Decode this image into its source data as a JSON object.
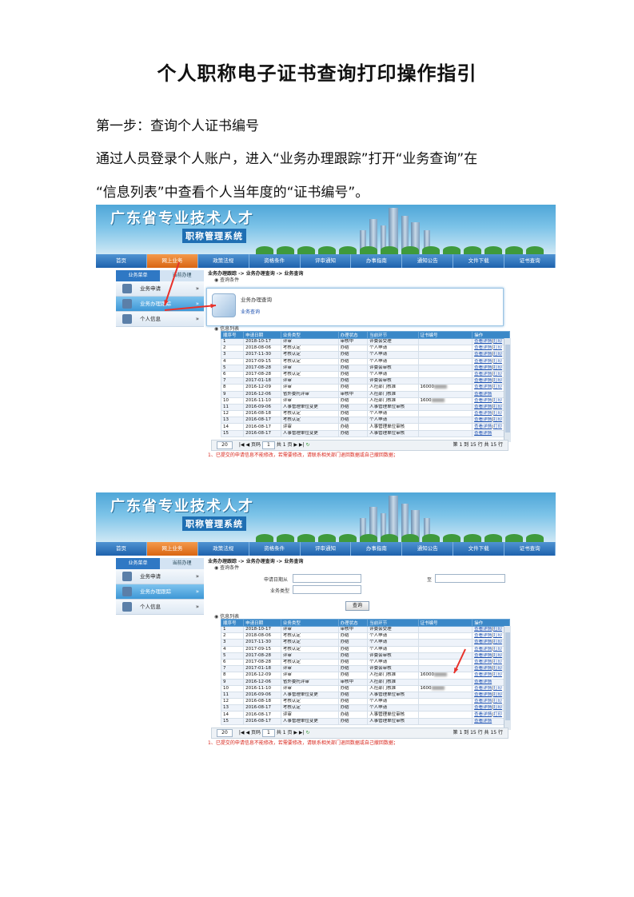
{
  "title": "个人职称电子证书查询打印操作指引",
  "step1": "第一步：查询个人证书编号",
  "intro_line1": "通过人员登录个人账户，进入“业务办理跟踪”打开“业务查询”在",
  "intro_line2": "“信息列表”中查看个人当年度的“证书编号”。",
  "banner": {
    "title": "广东省专业技术人才",
    "subtitle": "职称管理系统"
  },
  "nav": [
    "首页",
    "网上业务",
    "政策法规",
    "资格条件",
    "评审通知",
    "办事指南",
    "通知公告",
    "文件下载",
    "证书查询"
  ],
  "side_tabs": [
    "业务菜单",
    "当前办理"
  ],
  "side_items": [
    {
      "label": "业务申请",
      "arrow": "»"
    },
    {
      "label": "业务办理跟踪",
      "arrow": "»"
    },
    {
      "label": "个人信息",
      "arrow": "»"
    }
  ],
  "breadcrumb": "业务办理跟踪 -> 业务办理查询 -> 业务查询",
  "query_section": "查询条件",
  "popup": {
    "title": "业务办理查询",
    "link": "业务查询"
  },
  "form": {
    "date_label": "申请日期从",
    "to_label": "至",
    "type_label": "业务类型",
    "query_button": "查询"
  },
  "info_section": "信息列表",
  "table": {
    "headers": [
      "顺序号",
      "申请日期",
      "业务类型",
      "办理状态",
      "当前环节",
      "证书编号",
      "操作"
    ],
    "rows": [
      [
        "1",
        "2018-10-17",
        "评审",
        "审核中",
        "评委会受理",
        "",
        "查看详情|打印"
      ],
      [
        "2",
        "2018-08-06",
        "考核认定",
        "办结",
        "个人申请",
        "",
        "查看详情|打印"
      ],
      [
        "3",
        "2017-11-30",
        "考核认定",
        "办结",
        "个人申请",
        "",
        "查看详情|打印"
      ],
      [
        "4",
        "2017-09-15",
        "考核认定",
        "办结",
        "个人申请",
        "",
        "查看详情|打印"
      ],
      [
        "5",
        "2017-08-28",
        "评审",
        "办结",
        "评委会审核",
        "",
        "查看详情|打印"
      ],
      [
        "6",
        "2017-08-28",
        "考核认定",
        "办结",
        "个人申请",
        "",
        "查看详情|打印"
      ],
      [
        "7",
        "2017-01-18",
        "评审",
        "办结",
        "评委会审核",
        "",
        "查看详情|打印"
      ],
      [
        "8",
        "2016-12-09",
        "评审",
        "办结",
        "人社部门核准",
        "16000",
        "查看详情|打印"
      ],
      [
        "9",
        "2016-12-06",
        "省外委托评审",
        "审核中",
        "人社部门核准",
        "",
        "查看详情"
      ],
      [
        "10",
        "2016-11-10",
        "评审",
        "办结",
        "人社部门核准",
        "1600",
        "查看详情|打印"
      ],
      [
        "11",
        "2016-09-06",
        "人事管理单位变更",
        "办结",
        "人事管理单位审核",
        "",
        "查看详情|打印"
      ],
      [
        "12",
        "2016-08-18",
        "考核认定",
        "办结",
        "个人申请",
        "",
        "查看详情|打印"
      ],
      [
        "13",
        "2016-08-17",
        "考核认定",
        "办结",
        "个人申请",
        "",
        "查看详情|打印"
      ],
      [
        "14",
        "2016-08-17",
        "评审",
        "办结",
        "人事管理单位审核",
        "",
        "查看详情|打印"
      ],
      [
        "15",
        "2016-08-17",
        "人事管理单位变更",
        "办结",
        "人事管理单位审核",
        "",
        "查看详情"
      ]
    ]
  },
  "pager": {
    "size": "20",
    "page_label": "页码",
    "page": "1",
    "total": "共 1 页",
    "summary": "第 1 到 15 行 共 15 行"
  },
  "note": "1、已提交的申请信息不能修改，若需要修改，请联系相关部门退回数据或自己撤回数据；",
  "colors": {
    "nav": "#1e62ad",
    "nav_active": "#d96512",
    "header": "#3a88c8",
    "arrow": "#e8312a",
    "note": "#d9261c"
  }
}
